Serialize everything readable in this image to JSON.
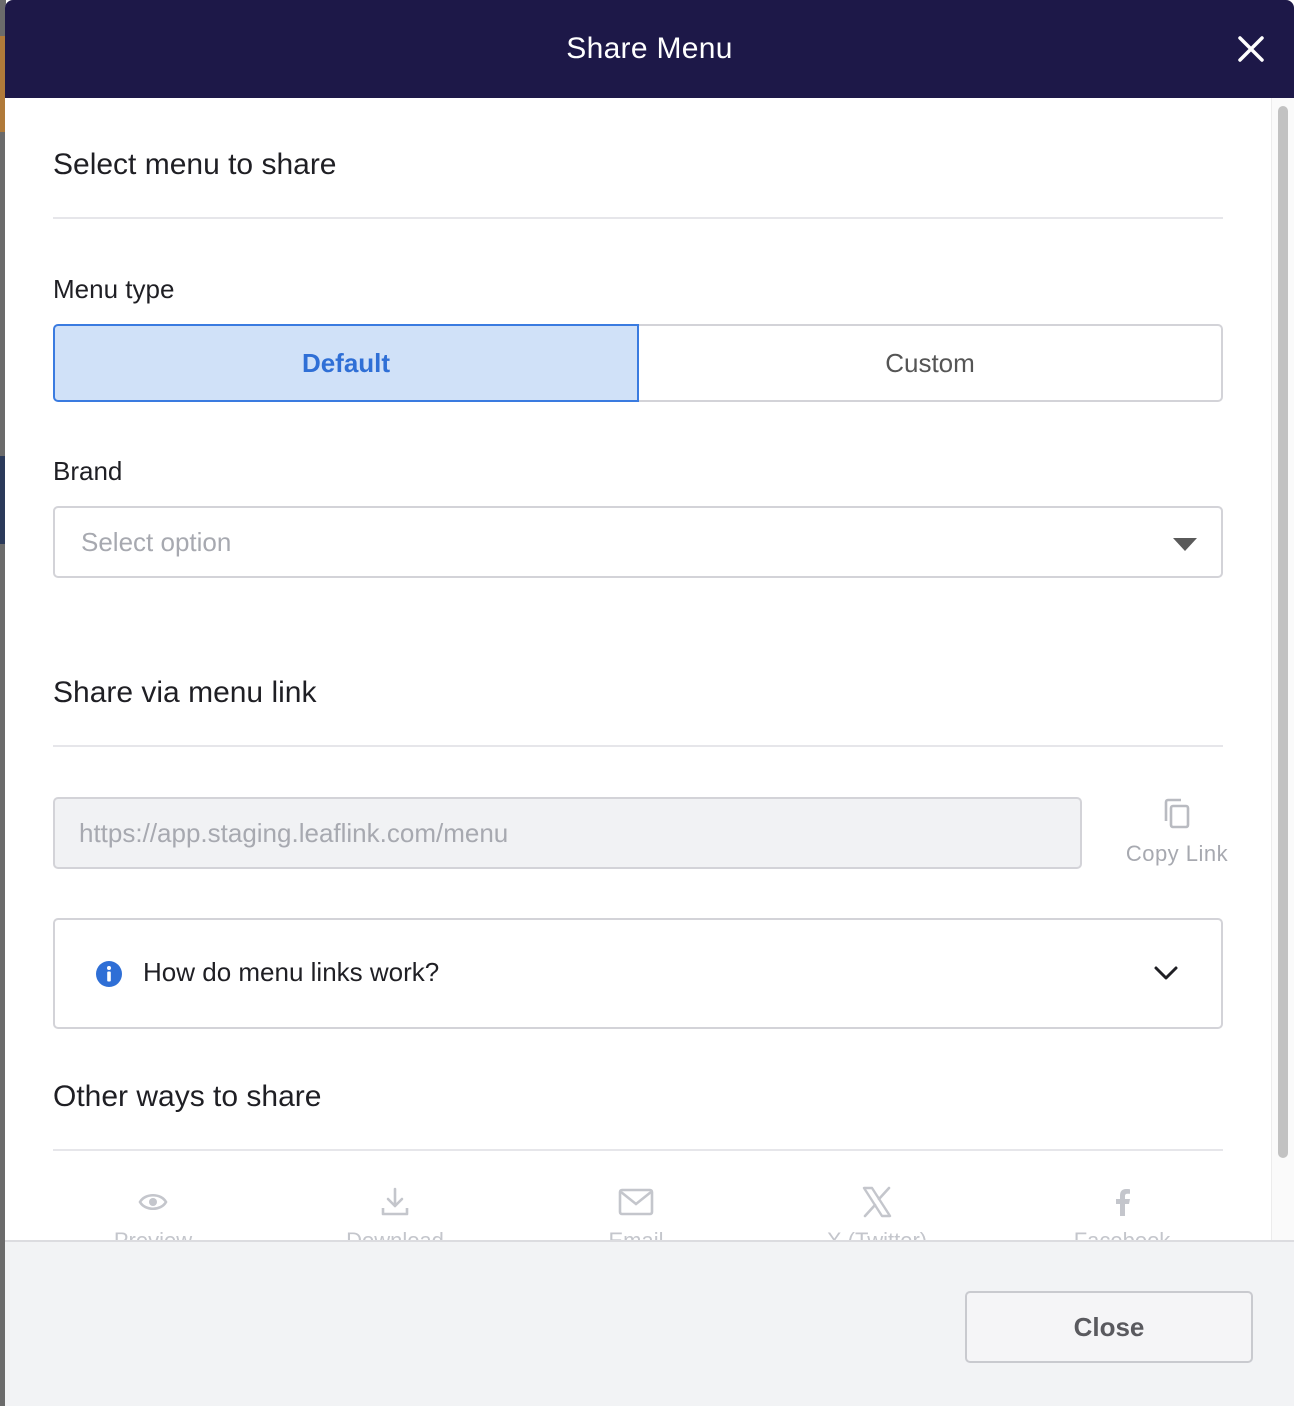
{
  "modal": {
    "title": "Share Menu"
  },
  "select_section": {
    "title": "Select menu to share",
    "menu_type_label": "Menu type",
    "menu_type_options": [
      "Default",
      "Custom"
    ],
    "menu_type_selected": "Default",
    "brand_label": "Brand",
    "brand_placeholder": "Select option"
  },
  "link_section": {
    "title": "Share via menu link",
    "link_placeholder": "https://app.staging.leaflink.com/menu",
    "copy_label": "Copy Link",
    "accordion_label": "How do menu links work?"
  },
  "other_section": {
    "title": "Other ways to share",
    "share_options": [
      {
        "icon": "eye-icon",
        "label": "Preview"
      },
      {
        "icon": "download-icon",
        "label": "Download"
      },
      {
        "icon": "mail-icon",
        "label": "Email"
      },
      {
        "icon": "x-twitter-icon",
        "label": "X (Twitter)"
      },
      {
        "icon": "facebook-icon",
        "label": "Facebook"
      }
    ]
  },
  "footer": {
    "close_label": "Close"
  },
  "colors": {
    "header_bg": "#1d1848",
    "accent": "#3a7be0",
    "active_bg": "#d0e1f8",
    "footer_bg": "#f2f3f5"
  }
}
